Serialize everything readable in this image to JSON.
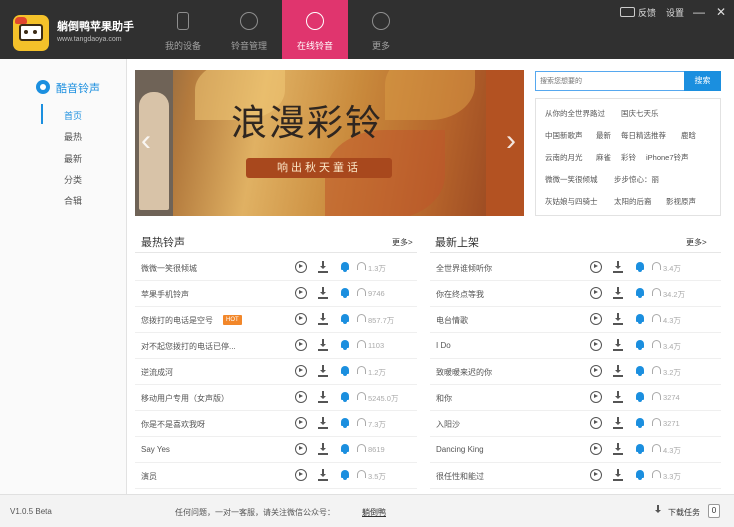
{
  "app": {
    "title": "躺倒鸭苹果助手",
    "url": "www.tangdaoya.com"
  },
  "nav": [
    {
      "label": "我的设备",
      "icon": "phone-icon"
    },
    {
      "label": "铃音管理",
      "icon": "ringtone-manage-icon"
    },
    {
      "label": "在线铃音",
      "icon": "music-note-icon"
    },
    {
      "label": "更多",
      "icon": "more-icon"
    }
  ],
  "window": {
    "feedback": "反馈",
    "settings": "设置",
    "minimize": "—",
    "close": "✕"
  },
  "sidebar": {
    "heading": "酷音铃声",
    "items": [
      {
        "label": "首页",
        "active": true
      },
      {
        "label": "最热"
      },
      {
        "label": "最新"
      },
      {
        "label": "分类"
      },
      {
        "label": "合辑"
      }
    ]
  },
  "banner": {
    "title": "浪漫彩铃",
    "subtitle": "响出秋天童话"
  },
  "search": {
    "placeholder": "搜索您想要的",
    "button": "搜索",
    "hot_words": [
      [
        "从你的全世界路过",
        "国庆七天乐"
      ],
      [
        "中国新歌声",
        "最新",
        "每日精选推荐",
        "鹿晗"
      ],
      [
        "云南的月光",
        "麻雀",
        "彩铃",
        "iPhone7铃声"
      ],
      [
        "微微一笑很倾城",
        "步步惊心：丽"
      ],
      [
        "灰姑娘与四骑士",
        "太阳的后裔",
        "影视原声"
      ]
    ]
  },
  "hot_list": {
    "title": "最热铃声",
    "more": "更多>",
    "rows": [
      {
        "name": "微微一笑很倾城",
        "count": "1.3万"
      },
      {
        "name": "苹果手机铃声",
        "count": "9746"
      },
      {
        "name": "您拨打的电话是空号",
        "count": "857.7万",
        "badge": "HOT"
      },
      {
        "name": "对不起您拨打的电话已停...",
        "count": "1103"
      },
      {
        "name": "逆流成河",
        "count": "1.2万"
      },
      {
        "name": "移动用户专用（女声版）",
        "count": "5245.0万"
      },
      {
        "name": "你是不是喜欢我呀",
        "count": "7.3万"
      },
      {
        "name": "Say Yes",
        "count": "8619"
      },
      {
        "name": "演员",
        "count": "3.5万"
      }
    ]
  },
  "new_list": {
    "title": "最新上架",
    "more": "更多>",
    "rows": [
      {
        "name": "全世界谁倾听你",
        "count": "3.4万"
      },
      {
        "name": "你在终点等我",
        "count": "34.2万"
      },
      {
        "name": "电台情歌",
        "count": "4.3万"
      },
      {
        "name": "I Do",
        "count": "3.4万"
      },
      {
        "name": "致暖暖来迟的你",
        "count": "3.2万"
      },
      {
        "name": "和你",
        "count": "3274"
      },
      {
        "name": "入阳沙",
        "count": "3271"
      },
      {
        "name": "Dancing King",
        "count": "4.3万"
      },
      {
        "name": "很任性和能过",
        "count": "3.3万"
      }
    ]
  },
  "status": {
    "version": "V1.0.5 Beta",
    "notice": "任何问题，一对一客服，请关注微信公众号：",
    "wechat": "躺倒鸭",
    "download_tasks": "下载任务",
    "download_count": "0"
  },
  "colors": {
    "accent": "#1b8fdf",
    "nav_active": "#e0356e",
    "topbar": "#303030",
    "hot_badge": "#f2872a"
  }
}
